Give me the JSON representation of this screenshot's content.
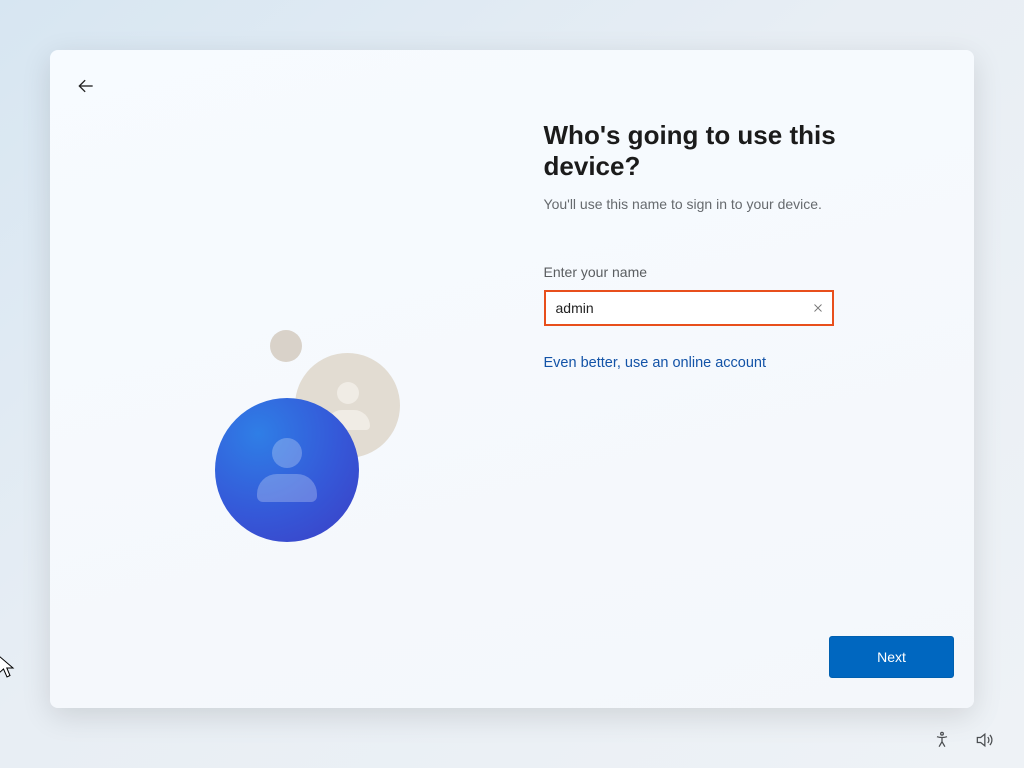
{
  "header": {
    "title": "Who's going to use this device?",
    "subtitle": "You'll use this name to sign in to your device."
  },
  "form": {
    "label": "Enter your name",
    "value": "admin",
    "online_link": "Even better, use an online account"
  },
  "actions": {
    "next_label": "Next"
  },
  "icons": {
    "back": "arrow-back",
    "clear": "close",
    "accessibility": "accessibility",
    "volume": "volume"
  },
  "colors": {
    "accent": "#0067c0",
    "input_border_highlight": "#e84f1c",
    "link": "#1353a7"
  }
}
